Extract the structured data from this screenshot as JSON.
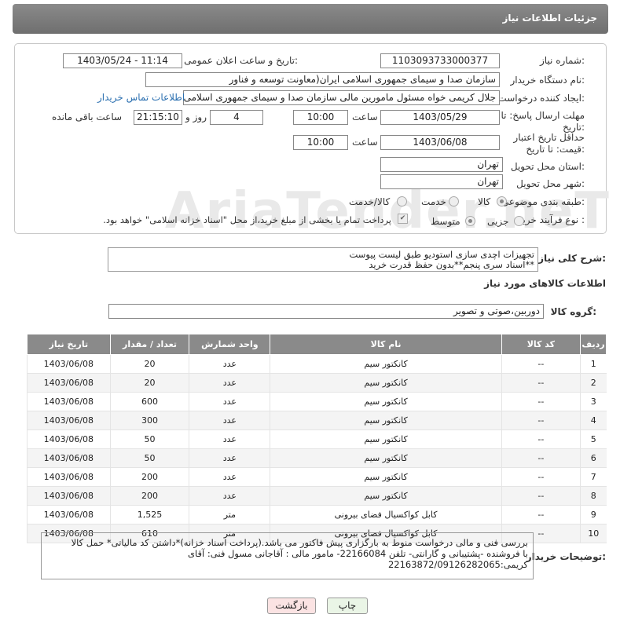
{
  "page": {
    "title": "جزئیات اطلاعات نیاز"
  },
  "watermark": "AriaTender.neT",
  "form": {
    "need_number_label": "شماره نیاز:",
    "need_number": "1103093733000377",
    "announce_label": "تاریخ و ساعت اعلان عمومی:",
    "announce_value": "1403/05/24 - 11:14",
    "buyer_org_label": "نام دستگاه خریدار:",
    "buyer_org": "سازمان صدا و سیمای جمهوری اسلامی ایران(معاونت توسعه و فناور",
    "creator_label": "ایجاد کننده درخواست:",
    "creator": "جلال کریمی خواه مسئول مامورین مالی  سازمان صدا و سیمای جمهوری اسلامی",
    "contact_link": "اطلاعات تماس خریدار",
    "deadline_label": "مهلت ارسال پاسخ: تا تاریخ:",
    "deadline_date": "1403/05/29",
    "time_label": "ساعت",
    "deadline_time": "10:00",
    "days_value": "4",
    "days_label": "روز و",
    "remaining_time": "21:15:10",
    "remaining_label": "ساعت باقی مانده",
    "validity_label": "حداقل تاریخ اعتبار قیمت: تا تاریخ:",
    "validity_date": "1403/06/08",
    "validity_time": "10:00",
    "province_label": "استان محل تحویل:",
    "province": "تهران",
    "city_label": "شهر محل تحویل:",
    "city": "تهران",
    "category_label": "طبقه بندی موضوعی:",
    "category_options": [
      "کالا",
      "خدمت",
      "کالا/خدمت"
    ],
    "process_label": "نوع فرآیند خرید :",
    "process_options": [
      "جزیی",
      "متوسط"
    ],
    "payment_note": "پرداخت تمام یا بخشی از مبلغ خرید،از محل \"اسناد خزانه اسلامی\" خواهد بود."
  },
  "summary": {
    "label": "شرح کلی نیاز:",
    "line1": "تجهیزات اچدی سازی استودیو طبق لیست پیوست",
    "line2": "**اسناد سری پنجم**بدون حفظ قدرت خرید"
  },
  "goods": {
    "section_title": "اطلاعات کالاهای مورد نیاز",
    "group_label": "گروه کالا:",
    "group_value": "دوربین،صوتی و تصویر",
    "headers": [
      "ردیف",
      "کد کالا",
      "نام کالا",
      "واحد شمارش",
      "تعداد / مقدار",
      "تاریخ نیاز"
    ],
    "rows": [
      [
        "1",
        "--",
        "کانکتور سیم",
        "عدد",
        "20",
        "1403/06/08"
      ],
      [
        "2",
        "--",
        "کانکتور سیم",
        "عدد",
        "20",
        "1403/06/08"
      ],
      [
        "3",
        "--",
        "کانکتور سیم",
        "عدد",
        "600",
        "1403/06/08"
      ],
      [
        "4",
        "--",
        "کانکتور سیم",
        "عدد",
        "300",
        "1403/06/08"
      ],
      [
        "5",
        "--",
        "کانکتور سیم",
        "عدد",
        "50",
        "1403/06/08"
      ],
      [
        "6",
        "--",
        "کانکتور سیم",
        "عدد",
        "50",
        "1403/06/08"
      ],
      [
        "7",
        "--",
        "کانکتور سیم",
        "عدد",
        "200",
        "1403/06/08"
      ],
      [
        "8",
        "--",
        "کانکتور سیم",
        "عدد",
        "200",
        "1403/06/08"
      ],
      [
        "9",
        "--",
        "کابل کواکسیال فضای بیرونی",
        "متر",
        "1,525",
        "1403/06/08"
      ],
      [
        "10",
        "--",
        "کابل کواکسیال فضای بیرونی",
        "متر",
        "610",
        "1403/06/08"
      ]
    ]
  },
  "buyer_notes": {
    "label": "توضیحات خریدار:",
    "line1": "بررسی فنی و مالی درخواست منوط به بارگزاری پیش فاکتور می باشد.(پرداخت اسناد خزانه)*داشتن کد مالیاتی*  حمل کالا",
    "line2": "با فروشنده -پشتیبانی و گارانتی- تلفن 22166084- مامور مالی : آقاجانی مسول فنی: آقای",
    "line3": "کریمی:22163872/09126282065"
  },
  "buttons": {
    "print": "چاپ",
    "back": "بازگشت"
  },
  "colors": {
    "header": "#7d7d7d",
    "link": "#2a6fb0",
    "back_button": "#fbe3e3",
    "print_button": "#eaf5e6"
  }
}
